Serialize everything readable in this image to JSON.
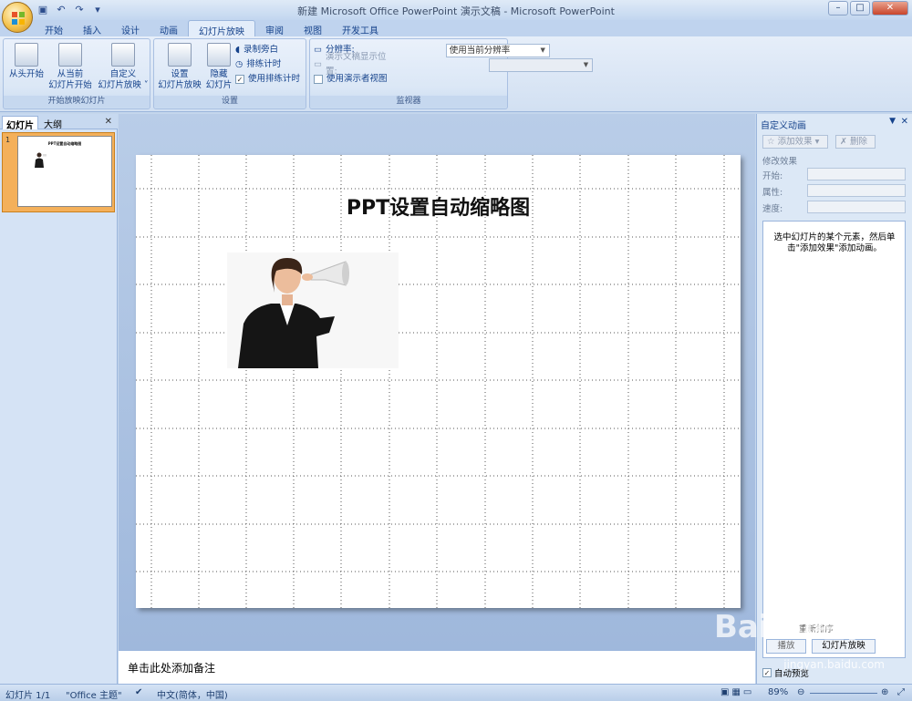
{
  "window": {
    "title": "新建 Microsoft Office PowerPoint 演示文稿 - Microsoft PowerPoint",
    "controls": [
      "–",
      "□",
      "✕"
    ]
  },
  "quick_access": {
    "icons": [
      "save-icon",
      "undo-icon",
      "redo-icon",
      "customize-icon"
    ]
  },
  "tabs": [
    "开始",
    "插入",
    "设计",
    "动画",
    "幻灯片放映",
    "审阅",
    "视图",
    "开发工具"
  ],
  "active_tab": "幻灯片放映",
  "ribbon": {
    "start_group": {
      "caption": "开始放映幻灯片",
      "from_start": "从头开始",
      "from_current_1": "从当前",
      "from_current_2": "幻灯片开始",
      "custom_1": "自定义",
      "custom_2": "幻灯片放映 ˅"
    },
    "setup_group": {
      "caption": "设置",
      "setup_1": "设置",
      "setup_2": "幻灯片放映",
      "hide_1": "隐藏",
      "hide_2": "幻灯片",
      "record": "录制旁白",
      "rehearse": "排练计时",
      "use_timings": "使用排练计时",
      "use_timings_checked": "✓"
    },
    "monitor_group": {
      "caption": "监视器",
      "resolution_label": "分辨率:",
      "resolution_value": "使用当前分辨率",
      "show_on_label": "演示文稿显示位置:",
      "presenter_view": "使用演示者视图"
    }
  },
  "left_pane": {
    "tab_slides": "幻灯片",
    "tab_outline": "大纲",
    "close": "✕",
    "thumb_number": "1",
    "thumb_title": "PPT设置自动缩略图"
  },
  "slide": {
    "title": "PPT设置自动缩略图"
  },
  "notes": {
    "placeholder": "单击此处添加备注"
  },
  "right_pane": {
    "title": "自定义动画",
    "add_effect": "添加效果 ▾",
    "remove": "删除",
    "modify_label": "修改效果",
    "start_label": "开始:",
    "property_label": "属性:",
    "speed_label": "速度:",
    "hint": "选中幻灯片的某个元素，然后单击\"添加效果\"添加动画。",
    "reorder": "重新排序",
    "play": "播放",
    "slideshow": "幻灯片放映",
    "autopreview": "自动预览"
  },
  "status": {
    "slide": "幻灯片 1/1",
    "theme": "\"Office 主题\"",
    "language": "中文(简体，中国)",
    "zoom": "89%"
  },
  "watermark": {
    "brand": "Baidu经验",
    "url": "jingyan.baidu.com"
  }
}
